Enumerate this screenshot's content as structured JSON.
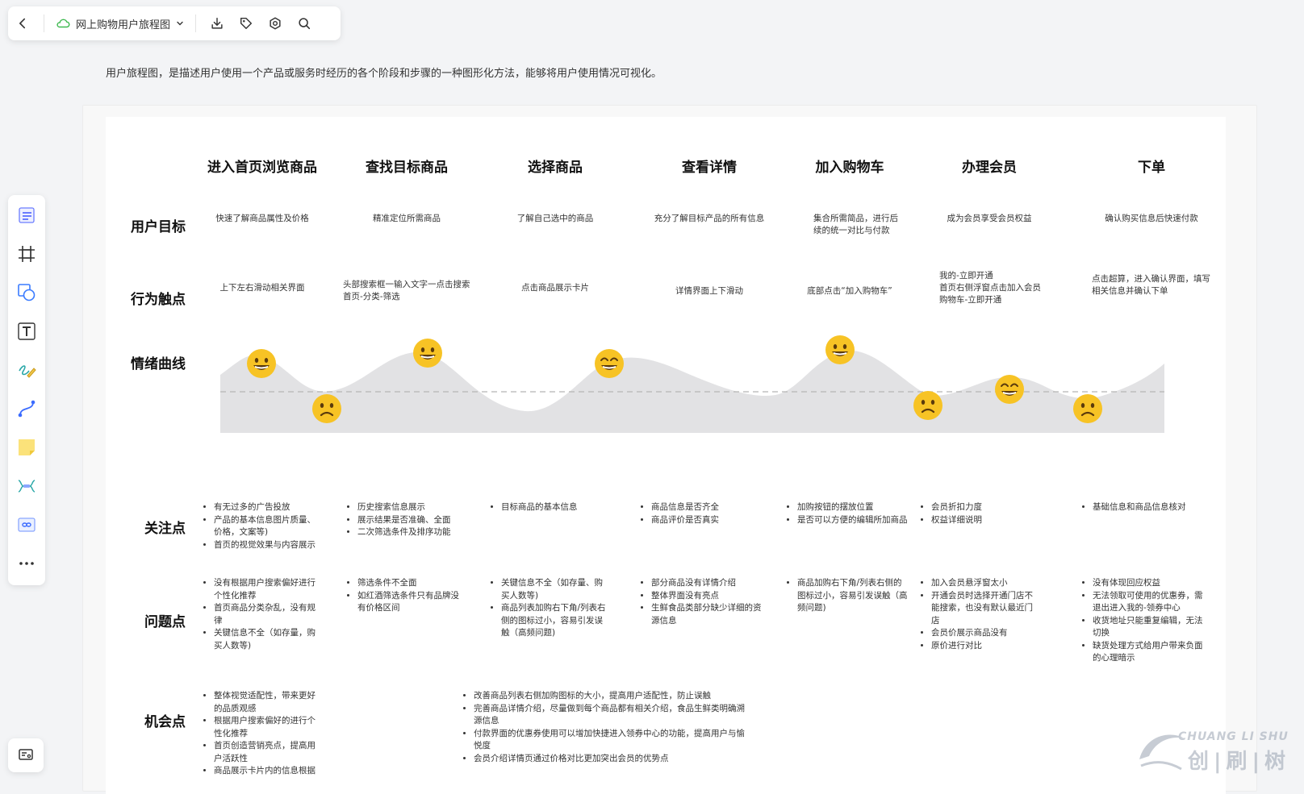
{
  "toolbar": {
    "title": "网上购物用户旅程图",
    "icons": [
      "back-icon",
      "cloud-icon",
      "chevron-down-icon",
      "download-icon",
      "tag-icon",
      "settings-icon",
      "search-icon"
    ]
  },
  "description": "用户旅程图，是描述用户使用一个产品或服务时经历的各个阶段和步骤的一种图形化方法，能够将用户使用情况可视化。",
  "tools": [
    "outline-icon",
    "frame-icon",
    "shape-icon",
    "text-icon",
    "pen-icon",
    "connector-icon",
    "sticky-note-icon",
    "mindmap-icon",
    "embed-link-icon",
    "more-icon",
    "present-icon"
  ],
  "stages": [
    "进入首页浏览商品",
    "查找目标商品",
    "选择商品",
    "查看详情",
    "加入购物车",
    "办理会员",
    "下单"
  ],
  "row_labels": {
    "goal": "用户目标",
    "touch": "行为触点",
    "emotion": "情绪曲线",
    "focus": "关注点",
    "problem": "问题点",
    "opportunity": "机会点"
  },
  "goals": [
    "快速了解商品属性及价格",
    "精准定位所需商品",
    "了解自己选中的商品",
    "充分了解目标产品的所有信息",
    "集合所需简品，进行后\n续的统一对比与付款",
    "成为会员享受会员权益",
    "确认购买信息后快速付款"
  ],
  "touchpoints": [
    "上下左右滑动相关界面",
    "头部搜索框一输入文字一点击搜索\n首页-分类-筛选",
    "点击商品展示卡片",
    "详情界面上下滑动",
    "底部点击“加入购物车”",
    "我的-立即开通\n首页右侧浮窗点击加入会员\n购物车-立即开通",
    "点击超算，进入确认界面，填写\n相关信息并确认下单"
  ],
  "emotion_points": [
    {
      "mood": "happy"
    },
    {
      "mood": "sad"
    },
    {
      "mood": "happy"
    },
    {
      "mood": "happy"
    },
    {
      "mood": "happy"
    },
    {
      "mood": "sad"
    },
    {
      "mood": "happy"
    },
    {
      "mood": "sad"
    }
  ],
  "focus": [
    [
      "有无过多的广告投放",
      "产品的基本信息图片质量、价格，文案等)",
      "首页的视觉效果与内容展示"
    ],
    [
      "历史搜索信息展示",
      "展示结果是否准确、全面",
      "二次筛选条件及排序功能"
    ],
    [
      "目标商品的基本信息"
    ],
    [
      "商品信息是否齐全",
      "商品评价是否真实"
    ],
    [
      "加购按钮的摆放位置",
      "是否可以方便的编辑所加商品"
    ],
    [
      "会员折扣力度",
      "权益详细说明"
    ],
    [
      "基础信息和商品信息核对"
    ]
  ],
  "problems": [
    [
      "没有根据用户搜索偏好进行个性化推荐",
      "首页商品分类杂乱，没有规律",
      "关键信息不全（如存量，购买人数等)"
    ],
    [
      "筛选条件不全面",
      "如红酒筛选条件只有品牌没有价格区间"
    ],
    [
      "关键信息不全（如存量、购买人数等)",
      "商品列表加购右下角/列表右侧的图标过小，容易引发误触（高频问题)"
    ],
    [
      "部分商品没有详情介绍",
      "整体界面没有亮点",
      "生鲜食品类部分缺少详细的资源信息"
    ],
    [
      "商品加购右下角/列表右侧的图标过小，容易引发误触（高频问题)"
    ],
    [
      "加入会员悬浮窗太小",
      "开通会员时选择开通门店不能搜索，也没有默认最近门店",
      "会员价展示商品没有",
      "原价进行对比"
    ],
    [
      "没有体现回应权益",
      "无法领取可使用的优惠券，需退出进入我的-领券中心",
      "收货地址只能重复编辑，无法切换",
      "缺货处理方式给用户带来负面的心理暗示"
    ]
  ],
  "opportunities": {
    "left": [
      "整体视觉适配性，带来更好的品质观感",
      "根据用户搜索偏好的进行个性化推荐",
      "首页创造营销亮点，提高用户活跃性",
      "商品展示卡片内的信息根据"
    ],
    "middle": [
      "改善商品列表右侧加购图标的大小，提高用户适配性，防止误触",
      "完善商品详情介绍，尽量做到每个商品都有相关介绍，食品生鲜类明确溯源信息",
      "付款界面的优惠券使用可以增加快捷进入领券中心的功能，提高用户与愉悦度",
      "会员介绍详情页通过价格对比更加突出会员的优势点"
    ]
  },
  "watermark": {
    "latin": "CHUANG LI SHU",
    "cjk": "创|刷|树"
  },
  "colors": {
    "emoji": "#f7c325",
    "curve_fill": "#e2e2e4",
    "accent_green": "#3fb950"
  }
}
